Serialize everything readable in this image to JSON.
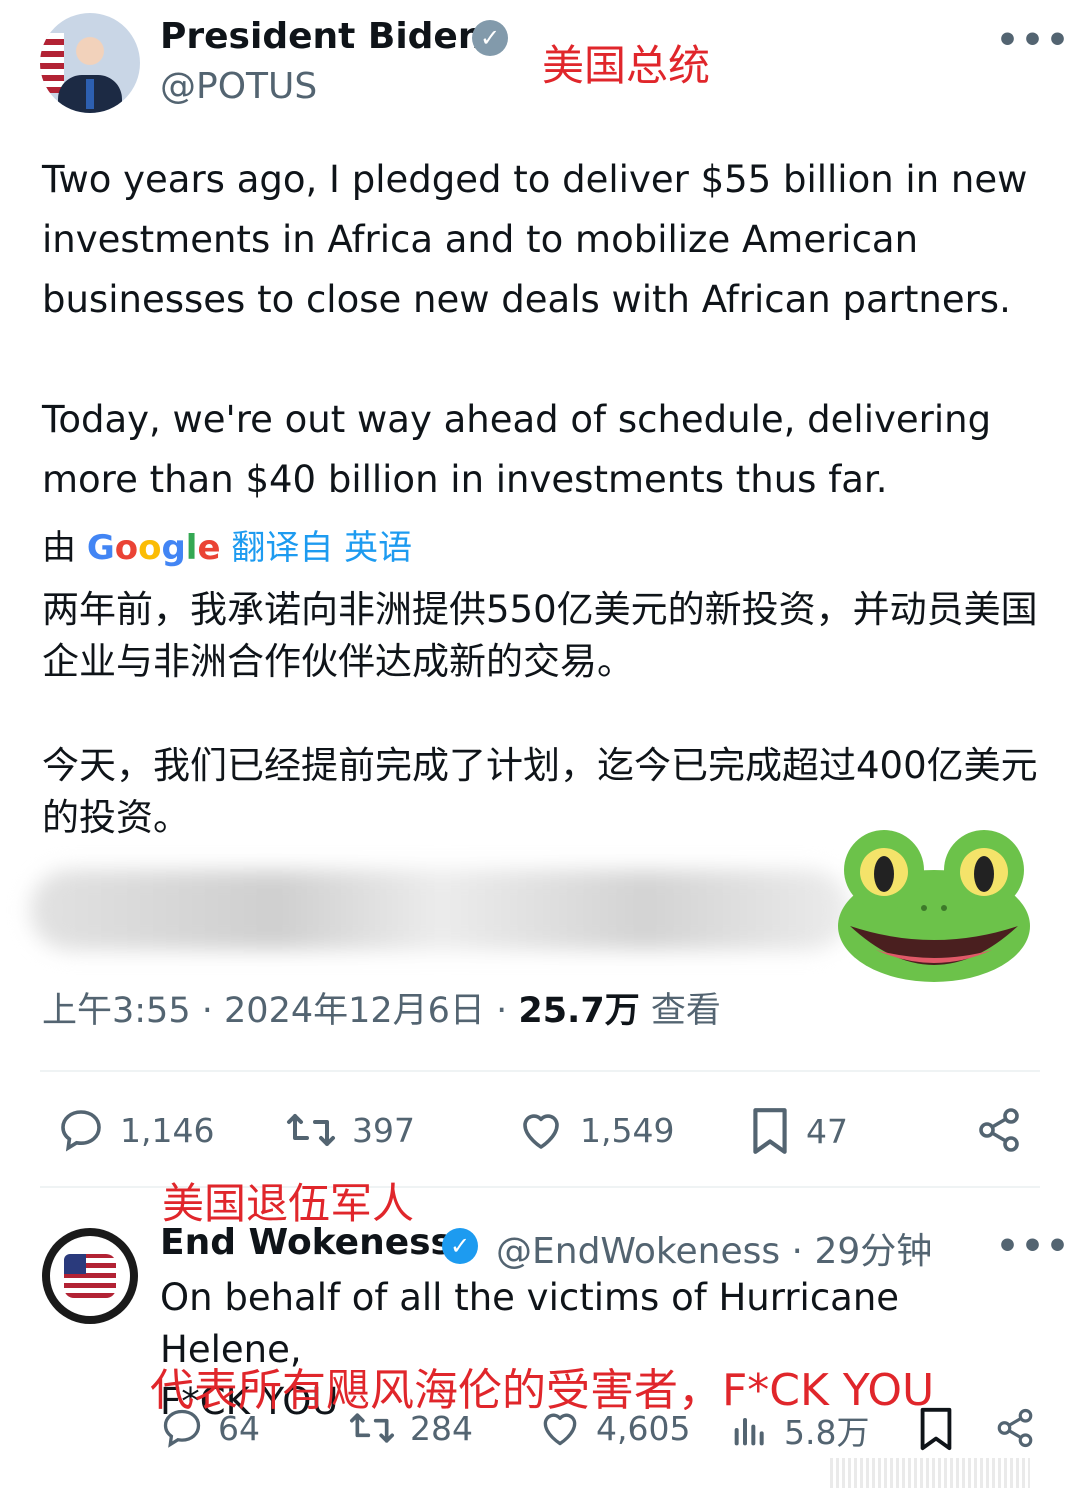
{
  "main_tweet": {
    "author_name": "President Biden",
    "handle": "@POTUS",
    "annotation": "美国总统",
    "more_glyph": "•••",
    "text_en": "Two years ago, I pledged to deliver $55 billion in new investments in Africa and to mobilize American businesses to close new deals with African partners.\n\nToday, we're out way ahead of schedule, delivering more than $40 billion in investments thus far.",
    "translate_prefix": "由",
    "translate_brand": "Google",
    "translate_link": "翻译自 英语",
    "text_zh": "两年前，我承诺向非洲提供550亿美元的新投资，并动员美国企业与非洲合作伙伴达成新的交易。\n\n今天，我们已经提前完成了计划，迄今已完成超过400亿美元的投资。",
    "time": "上午3:55",
    "date": "2024年12月6日",
    "views": "25.7万",
    "views_label": "查看",
    "stats": {
      "replies": "1,146",
      "retweets": "397",
      "likes": "1,549",
      "bookmarks": "47"
    }
  },
  "reply": {
    "annotation": "美国退伍军人",
    "author_name": "End Wokeness",
    "handle_time": "@EndWokeness · 29分钟",
    "more_glyph": "•••",
    "text": "On behalf of all the victims of Hurricane Helene,\nF*CK YOU",
    "translation_overlay": "代表所有飓风海伦的受害者，F*CK YOU",
    "stats": {
      "replies": "64",
      "retweets": "284",
      "likes": "4,605",
      "views": "5.8万"
    }
  },
  "colors": {
    "accent": "#1d9bf0",
    "annotation_red": "#e0262b",
    "muted": "#536471",
    "frog_green": "#6cc24a"
  }
}
